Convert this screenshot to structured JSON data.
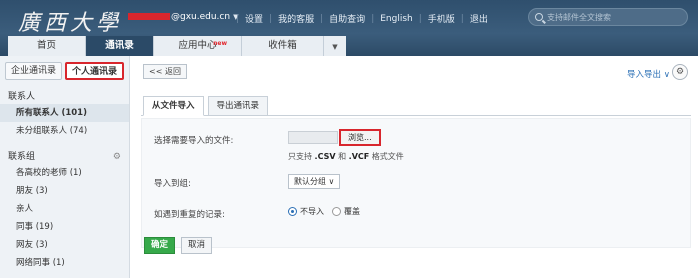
{
  "header": {
    "logo": "廣西大學",
    "account": "@gxu.edu.cn",
    "links": [
      "设置",
      "我的客服",
      "自助查询",
      "English",
      "手机版",
      "退出"
    ],
    "search_placeholder": "支持邮件全文搜索"
  },
  "nav": {
    "tabs": [
      "首页",
      "通讯录",
      "应用中心",
      "收件箱"
    ],
    "badge": "new"
  },
  "sidebar": {
    "tabs": [
      "企业通讯录",
      "个人通讯录"
    ],
    "contacts_title": "联系人",
    "contacts": [
      "所有联系人 (101)",
      "未分组联系人 (74)"
    ],
    "groups_title": "联系组",
    "groups": [
      "各高校的老师 (1)",
      "朋友 (3)",
      "亲人",
      "同事 (19)",
      "网友 (3)",
      "网络同事 (1)"
    ]
  },
  "main": {
    "back_label": "<< 返回",
    "io_label": "导入导出",
    "tabs": [
      "从文件导入",
      "导出通讯录"
    ],
    "file_label": "选择需要导入的文件:",
    "browse_label": "浏览...",
    "hint_prefix": "只支持",
    "hint_csv": ".CSV",
    "hint_and": "和",
    "hint_vcf": ".VCF",
    "hint_suffix": "格式文件",
    "group_label": "导入到组:",
    "group_value": "默认分组",
    "dup_label": "如遇到重复的记录:",
    "dup_options": [
      "不导入",
      "覆盖"
    ],
    "confirm_label": "确定",
    "cancel_label": "取消"
  },
  "colors": {
    "header_bg": "#2f4f6d",
    "highlight": "#d8262d",
    "confirm": "#36a94a",
    "link": "#2a6fb5"
  }
}
